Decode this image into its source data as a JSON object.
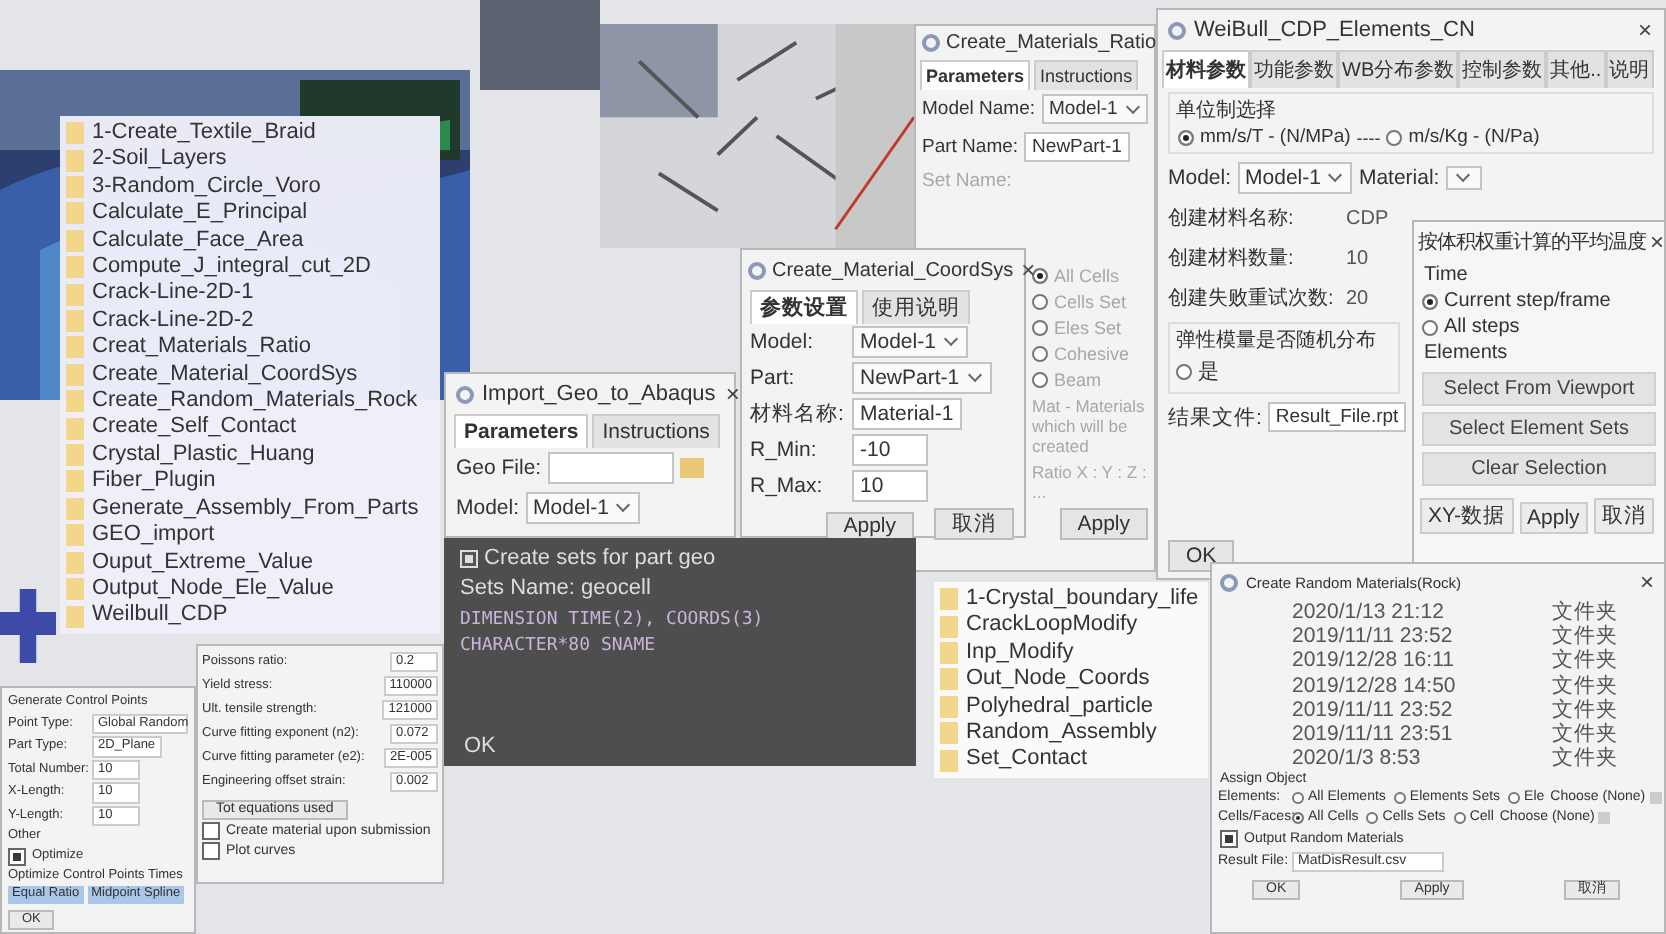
{
  "folders_a": [
    "1-Create_Textile_Braid",
    "2-Soil_Layers",
    "3-Random_Circle_Voro",
    "Calculate_E_Principal",
    "Calculate_Face_Area",
    "Compute_J_integral_cut_2D",
    "Crack-Line-2D-1",
    "Crack-Line-2D-2",
    "Creat_Materials_Ratio",
    "Create_Material_CoordSys",
    "Create_Random_Materials_Rock",
    "Create_Self_Contact",
    "Crystal_Plastic_Huang",
    "Fiber_Plugin",
    "Generate_Assembly_From_Parts",
    "GEO_import",
    "Ouput_Extreme_Value",
    "Output_Node_Ele_Value",
    "Weilbull_CDP"
  ],
  "import_geo": {
    "title": "Import_Geo_to_Abaqus",
    "close": "×",
    "tabs": [
      {
        "label": "Parameters",
        "selected": true
      },
      {
        "label": "Instructions",
        "selected": false
      }
    ],
    "geo_file_label": "Geo File:",
    "model_label": "Model:",
    "model_value": "Model-1"
  },
  "code_panel": {
    "checkbox_label": "Create sets for part geo",
    "checked": true,
    "sets_label": "Sets Name:",
    "sets_value": "geocell",
    "lines": [
      "DIMENSION TIME(2), COORDS(3)",
      "CHARACTER*80 SNAME"
    ],
    "ok": "OK"
  },
  "materials_ratio": {
    "title": "Create_Materials_Ratio",
    "tabs": [
      {
        "label": "Parameters",
        "selected": true
      },
      {
        "label": "Instructions",
        "selected": false
      }
    ],
    "rows": [
      {
        "label": "Model Name:",
        "value": "Model-1",
        "kind": "select"
      },
      {
        "label": "Part Name:",
        "value": "NewPart-1",
        "kind": "text"
      },
      {
        "label": "Set Name:",
        "kind": "disabled"
      }
    ],
    "radios": [
      {
        "label": "All Cells",
        "selected": true
      },
      {
        "label": "Cells Set",
        "selected": false
      },
      {
        "label": "Eles Set",
        "selected": false
      },
      {
        "label": "Cohesive",
        "selected": false
      },
      {
        "label": "Beam",
        "selected": false
      }
    ],
    "note": "Mat - Materials which will be created",
    "ratio": "Ratio X : Y : Z : ...",
    "apply": "Apply"
  },
  "coordsys": {
    "title": "Create_Material_CoordSys",
    "close": "×",
    "tabs": [
      {
        "label": "参数设置",
        "selected": true
      },
      {
        "label": "使用说明",
        "selected": false
      }
    ],
    "rows": [
      {
        "label": "Model:",
        "value": "Model-1",
        "kind": "select"
      },
      {
        "label": "Part:",
        "value": "NewPart-1",
        "kind": "select"
      },
      {
        "label": "材料名称:",
        "value": "Material-1",
        "kind": "text"
      },
      {
        "label": "R_Min:",
        "value": "-10",
        "kind": "text"
      },
      {
        "label": "R_Max:",
        "value": "10",
        "kind": "text"
      }
    ],
    "buttons": [
      "Apply",
      "取消"
    ]
  },
  "weibull": {
    "title": "WeiBull_CDP_Elements_CN",
    "close": "×",
    "tabs": [
      {
        "label": "材料参数",
        "selected": true
      },
      {
        "label": "功能参数",
        "selected": false
      },
      {
        "label": "WB分布参数",
        "selected": false
      },
      {
        "label": "控制参数",
        "selected": false
      },
      {
        "label": "其他..",
        "selected": false
      },
      {
        "label": "说明",
        "selected": false
      }
    ],
    "unit_group": "单位制选择",
    "units": [
      {
        "label": "mm/s/T - (N/MPa)",
        "selected": true
      },
      {
        "label": "m/s/Kg - (N/Pa)",
        "selected": false
      }
    ],
    "unit_sep": "----",
    "model_label": "Model:",
    "model_value": "Model-1",
    "material_label": "Material:",
    "rows": [
      {
        "label": "创建材料名称:",
        "value": "CDP"
      },
      {
        "label": "创建材料数量:",
        "value": "10"
      },
      {
        "label": "创建失败重试次数:",
        "value": "20"
      }
    ],
    "elastic_group": "弹性模量是否随机分布",
    "elastic_option": {
      "label": "是",
      "selected": false
    },
    "result_label": "结果文件:",
    "result_value": "Result_File.rpt",
    "ok": "OK"
  },
  "avg_temp": {
    "title": "按体积权重计算的平均温度",
    "close": "×",
    "time_label": "Time",
    "time_options": [
      {
        "label": "Current step/frame",
        "selected": true
      },
      {
        "label": "All steps",
        "selected": false
      }
    ],
    "elements_label": "Elements",
    "buttons": [
      "Select From Viewport",
      "Select Element Sets",
      "Clear Selection"
    ],
    "footer": [
      "XY-数据",
      "Apply",
      "取消"
    ]
  },
  "folders_b": [
    "1-Crystal_boundary_life",
    "CrackLoopModify",
    "Inp_Modify",
    "Out_Node_Coords",
    "Polyhedral_particle",
    "Random_Assembly",
    "Set_Contact"
  ],
  "random_materials": {
    "title": "Create Random Materials(Rock)",
    "close": "×",
    "dates": [
      {
        "date": "2020/1/13 21:12",
        "type": "文件夹"
      },
      {
        "date": "2019/11/11 23:52",
        "type": "文件夹"
      },
      {
        "date": "2019/12/28 16:11",
        "type": "文件夹"
      },
      {
        "date": "2019/12/28 14:50",
        "type": "文件夹"
      },
      {
        "date": "2019/11/11 23:52",
        "type": "文件夹"
      },
      {
        "date": "2019/11/11 23:51",
        "type": "文件夹"
      },
      {
        "date": "2020/1/3 8:53",
        "type": "文件夹"
      }
    ],
    "assign_label": "Assign Object",
    "assign_rows": [
      {
        "label": "Elements:",
        "options": [
          {
            "label": "All Elements",
            "selected": false
          },
          {
            "label": "Elements Sets",
            "selected": false
          },
          {
            "label": "Ele",
            "selected": false
          }
        ],
        "choose": "Choose (None)"
      },
      {
        "label": "Cells/Faces:",
        "options": [
          {
            "label": "All Cells",
            "selected": true
          },
          {
            "label": "Cells Sets",
            "selected": false
          },
          {
            "label": "Cell",
            "selected": false
          }
        ],
        "choose": "Choose (None)"
      }
    ],
    "output": {
      "label": "Output Random Materials",
      "checked": true
    },
    "result_label": "Result File:",
    "result_value": "MatDisResult.csv",
    "buttons": [
      "OK",
      "Apply",
      "取消"
    ]
  },
  "control_points": {
    "title": "Generate Control Points",
    "rows": [
      {
        "label": "Point Type:",
        "value": "Global Random"
      },
      {
        "label": "Part Type:",
        "value": "2D_Plane"
      },
      {
        "label": "Total Number:",
        "value": "10"
      },
      {
        "label": "X-Length:",
        "value": "10"
      },
      {
        "label": "Y-Length:",
        "value": "10"
      }
    ],
    "other": "Other",
    "optimize": {
      "label": "Optimize",
      "checked": true
    },
    "times_label": "Optimize Control Points Times",
    "fills": [
      "Equal Ratio",
      "Midpoint Spline"
    ],
    "ok": "OK"
  },
  "material_props": {
    "rows": [
      {
        "label": "Poissons ratio:",
        "value": "0.2"
      },
      {
        "label": "Yield stress:",
        "value": "110000"
      },
      {
        "label": "Ult. tensile strength:",
        "value": "121000"
      },
      {
        "label": "Curve fitting exponent (n2):",
        "value": "0.072"
      },
      {
        "label": "Curve fitting parameter (e2):",
        "value": "2E-005"
      },
      {
        "label": "Engineering offset strain:",
        "value": "0.002"
      }
    ],
    "equations": "Tot equations used",
    "checks": [
      {
        "label": "Create material upon submission",
        "checked": false
      },
      {
        "label": "Plot curves",
        "checked": false
      }
    ]
  }
}
